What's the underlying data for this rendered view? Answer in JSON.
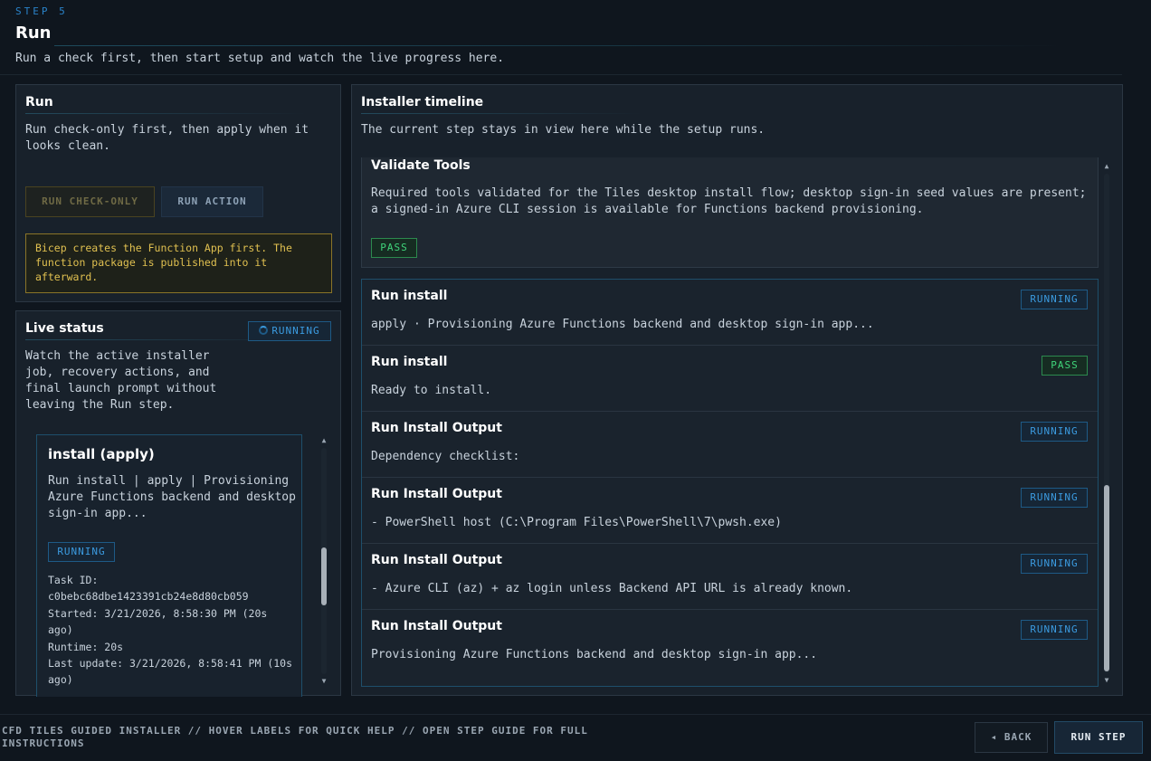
{
  "header": {
    "eyebrow": "STEP 5",
    "title": "Run",
    "subtitle": "Run a check first, then start setup and watch the live progress here."
  },
  "run_panel": {
    "title": "Run",
    "description": "Run check-only first, then apply when it looks clean.",
    "check_label": "RUN CHECK-ONLY",
    "run_label": "RUN ACTION",
    "notice": "Bicep creates the Function App first. The function package is published into it afterward."
  },
  "live_status": {
    "title": "Live status",
    "badge": "RUNNING",
    "description": "Watch the active installer job, recovery actions, and final launch prompt without leaving the Run step.",
    "job": {
      "title": "install (apply)",
      "description": "Run install | apply | Provisioning Azure Functions backend and desktop sign-in app...",
      "badge": "RUNNING",
      "task_id_label": "Task ID:",
      "task_id": "c0bebc68dbe1423391cb24e8d80cb059",
      "started": "Started: 3/21/2026, 8:58:30 PM (20s ago)",
      "runtime": "Runtime: 20s",
      "last_update": "Last update: 3/21/2026, 8:58:41 PM (10s ago)"
    }
  },
  "timeline": {
    "title": "Installer timeline",
    "description": "The current step stays in view here while the setup runs.",
    "first": {
      "title": "Validate Tools",
      "detail": "Required tools validated for the Tiles desktop install flow; desktop sign-in seed values are present; a signed-in Azure CLI session is available for Functions backend provisioning.",
      "status": "PASS"
    },
    "rows": [
      {
        "title": "Run install",
        "detail": "apply · Provisioning Azure Functions backend and desktop sign-in app...",
        "status": "RUNNING",
        "kind": "running"
      },
      {
        "title": "Run install",
        "detail": "Ready to install.",
        "status": "PASS",
        "kind": "pass"
      },
      {
        "title": "Run Install Output",
        "detail": "Dependency checklist:",
        "status": "RUNNING",
        "kind": "running"
      },
      {
        "title": "Run Install Output",
        "detail": "- PowerShell host (C:\\Program Files\\PowerShell\\7\\pwsh.exe)",
        "status": "RUNNING",
        "kind": "running"
      },
      {
        "title": "Run Install Output",
        "detail": "- Azure CLI (az) + az login unless Backend API URL is already known.",
        "status": "RUNNING",
        "kind": "running"
      },
      {
        "title": "Run Install Output",
        "detail": "Provisioning Azure Functions backend and desktop sign-in app...",
        "status": "RUNNING",
        "kind": "running"
      }
    ]
  },
  "footer": {
    "hint": "CFD TILES GUIDED INSTALLER // HOVER LABELS FOR QUICK HELP // OPEN STEP GUIDE FOR FULL INSTRUCTIONS",
    "back_label": "◂ BACK",
    "next_label": "RUN STEP"
  },
  "icons": {
    "scroll_up": "▲",
    "scroll_down": "▼",
    "spinner": "spinner-icon"
  },
  "colors": {
    "accent": "#3b9be0",
    "pass": "#3fd47a",
    "warning": "#e0c050",
    "background": "#0f161e"
  }
}
